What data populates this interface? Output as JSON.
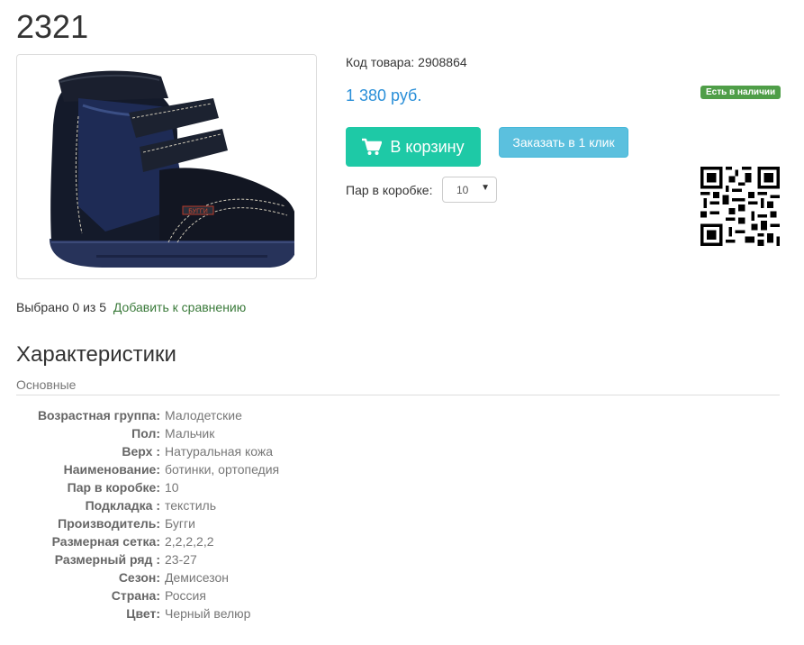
{
  "product": {
    "title": "2321",
    "code_label": "Код товара: 2908864",
    "price": "1 380 руб.",
    "stock_badge": "Есть в наличии",
    "cart_button": "В корзину",
    "order_button": "Заказать в 1 клик",
    "box_label": "Пар в коробке:",
    "box_value": "10",
    "image_alt": "black children's orthopedic boot with velcro straps",
    "brand_tag": "БУГГИ"
  },
  "compare": {
    "text": "Выбрано 0 из 5",
    "link": "Добавить к сравнению"
  },
  "specs": {
    "title": "Характеристики",
    "group": "Основные",
    "rows": [
      {
        "k": "Возрастная группа:",
        "v": "Малодетские"
      },
      {
        "k": "Пол:",
        "v": "Мальчик"
      },
      {
        "k": "Верх :",
        "v": "Натуральная кожа"
      },
      {
        "k": "Наименование:",
        "v": "ботинки, ортопедия"
      },
      {
        "k": "Пар в коробке:",
        "v": "10"
      },
      {
        "k": "Подкладка :",
        "v": "текстиль"
      },
      {
        "k": "Производитель:",
        "v": "Бугги"
      },
      {
        "k": "Размерная сетка:",
        "v": "2,2,2,2,2"
      },
      {
        "k": "Размерный ряд :",
        "v": "23-27"
      },
      {
        "k": "Сезон:",
        "v": "Демисезон"
      },
      {
        "k": "Страна:",
        "v": "Россия"
      },
      {
        "k": "Цвет:",
        "v": "Черный велюр"
      }
    ]
  },
  "colors": {
    "price": "#2a8fd8",
    "cart": "#1ec9a6",
    "order": "#5bc0de",
    "stock": "#4f9e48",
    "link": "#3a7a3a"
  }
}
